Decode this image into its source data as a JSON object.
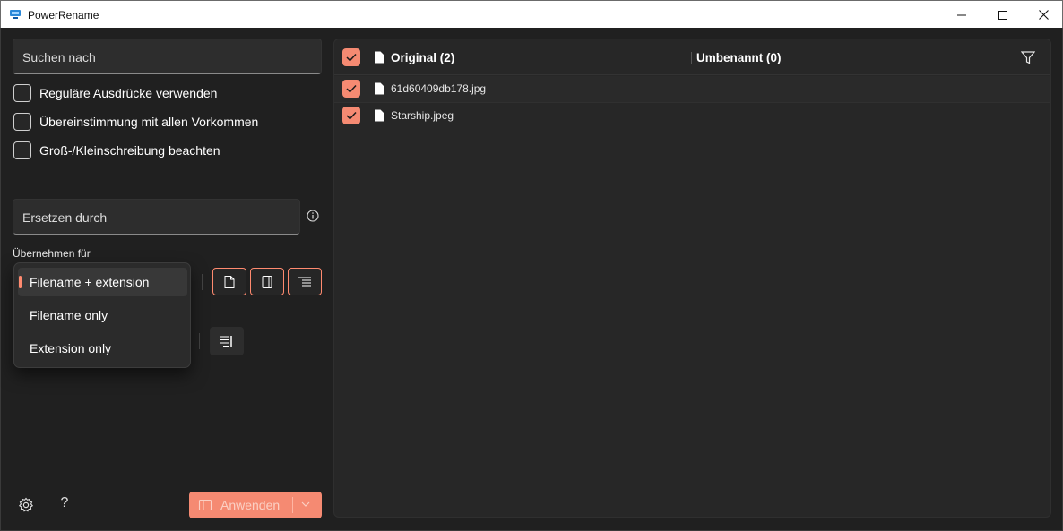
{
  "window": {
    "title": "PowerRename"
  },
  "search": {
    "placeholder": "Suchen nach"
  },
  "options": {
    "regex_label": "Reguläre Ausdrücke verwenden",
    "match_all_label": "Übereinstimmung mit allen Vorkommen",
    "case_label": "Groß-/Kleinschreibung beachten"
  },
  "replace": {
    "placeholder": "Ersetzen durch"
  },
  "apply_to": {
    "label": "Übernehmen für",
    "dropdown_options": [
      "Filename + extension",
      "Filename only",
      "Extension only"
    ],
    "selected": "Filename + extension"
  },
  "footer": {
    "apply_label": "Anwenden"
  },
  "file_list": {
    "original_header": "Original (2)",
    "renamed_header": "Umbenannt (0)",
    "rows": [
      {
        "name": "61d60409db178.jpg",
        "checked": true
      },
      {
        "name": "Starship.jpeg",
        "checked": true
      }
    ]
  },
  "colors": {
    "accent": "#f58a72",
    "background": "#202020",
    "panel": "#272727"
  },
  "icons": [
    "app-icon",
    "minimize-icon",
    "maximize-icon",
    "close-icon",
    "info-icon",
    "file-icon",
    "filter-icon",
    "settings-icon",
    "help-icon",
    "checkmark-icon",
    "chevron-down-icon",
    "enumerate-icon"
  ]
}
